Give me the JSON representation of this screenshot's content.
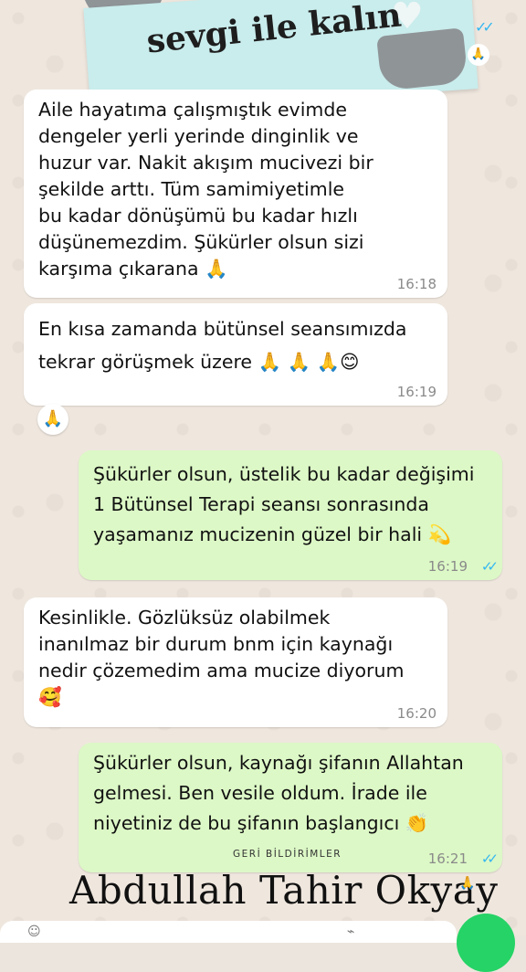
{
  "banner": {
    "text": "sevgi ile kalın"
  },
  "messages": [
    {
      "dir": "in",
      "text": "Aile hayatıma çalışmıştık evimde\ndengeler yerli yerinde dinginlik ve\nhuzur var. Nakit akışım mucivezi bir\nşekilde arttı. Tüm samimiyetimle\nbu kadar dönüşümü bu kadar hızlı\ndüşünemezdim. Şükürler olsun sizi\nkarşıma çıkarana 🙏",
      "time": "16:18"
    },
    {
      "dir": "in",
      "text": "En kısa zamanda bütünsel seansımızda\ntekrar görüşmek üzere 🙏 🙏 🙏😊",
      "time": "16:19"
    },
    {
      "dir": "out",
      "text": "Şükürler olsun, üstelik bu kadar değişimi\n1 Bütünsel Terapi seansı sonrasında\nyaşamanız mucizenin güzel bir hali 💫",
      "time": "16:19"
    },
    {
      "dir": "in",
      "text": "Kesinlikle.  Gözlüksüz olabilmek\ninanılmaz bir durum bnm için kaynağı\nnedir çözemedim ama mucize diyorum\n🥰",
      "time": "16:20"
    },
    {
      "dir": "out",
      "text": "Şükürler olsun, kaynağı şifanın Allahtan\ngelmesi. Ben vesile oldum. İrade ile\nniyetiniz de bu şifanın başlangıcı 👏",
      "time": "16:21"
    }
  ],
  "reactions": {
    "top": "🙏",
    "after_second": "🙏",
    "bottom": "🙏"
  },
  "feedback_label": "GERİ BİLDİRİMLER",
  "signature": "Abdullah Tahir Okyay",
  "colors": {
    "incoming": "#ffffff",
    "outgoing": "#dcf8c6",
    "read_ticks": "#34b7f1",
    "banner": "#c9ecec"
  },
  "icons": {
    "read_receipt": "double-check-icon",
    "send": "mic-icon"
  }
}
